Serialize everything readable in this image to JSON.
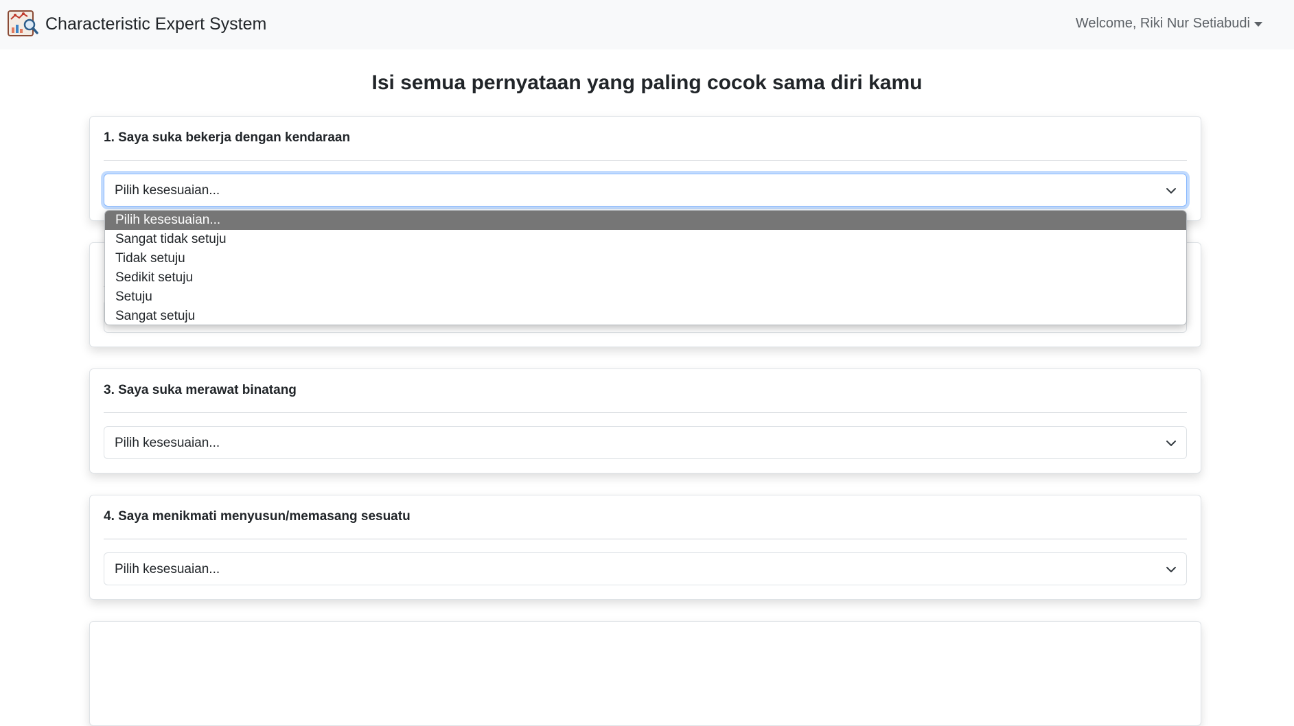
{
  "app": {
    "brand": "Characteristic Expert System",
    "user_menu": "Welcome, Riki Nur Setiabudi"
  },
  "page": {
    "title": "Isi semua pernyataan yang paling cocok sama diri kamu"
  },
  "questions": [
    {
      "label": "1. Saya suka bekerja dengan kendaraan",
      "value": "Pilih kesesuaian..."
    },
    {
      "label": "",
      "value": ""
    },
    {
      "label": "3. Saya suka merawat binatang",
      "value": "Pilih kesesuaian..."
    },
    {
      "label": "4. Saya menikmati menyusun/memasang sesuatu",
      "value": "Pilih kesesuaian..."
    }
  ],
  "dropdown": {
    "options": [
      "Pilih kesesuaian...",
      "Sangat tidak setuju",
      "Tidak setuju",
      "Sedikit setuju",
      "Setuju",
      "Sangat setuju"
    ],
    "highlighted": "Pilih kesesuaian..."
  },
  "colors": {
    "navbar_bg": "#f8f9fa",
    "focus_border": "#86b7fe",
    "option_highlight": "#767676"
  }
}
